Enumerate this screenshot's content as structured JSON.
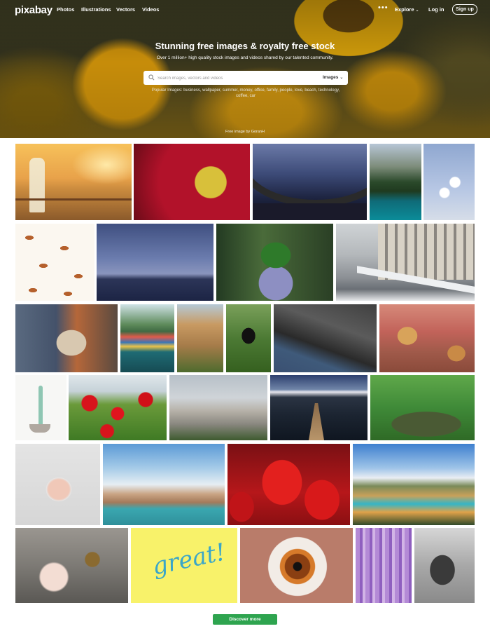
{
  "header": {
    "logo": "pixabay",
    "nav": [
      "Photos",
      "Illustrations",
      "Vectors",
      "Videos"
    ],
    "more_icon": "more-dots-icon",
    "explore_label": "Explore",
    "login_label": "Log in",
    "signup_label": "Sign up"
  },
  "hero": {
    "title": "Stunning free images & royalty free stock",
    "subtitle": "Over 1 million+ high quality stock images and videos shared by our talented community.",
    "search": {
      "placeholder": "Search images, vectors and videos",
      "type_label": "Images"
    },
    "popular": "Popular Images: business, wallpaper, summer, money, office, family, people, love, beach, technology, coffee, car",
    "credit": "Free image by GoranH"
  },
  "gallery": {
    "discover_label": "Discover more",
    "great_text": "great!"
  },
  "colors": {
    "accent": "#2ea44f"
  }
}
